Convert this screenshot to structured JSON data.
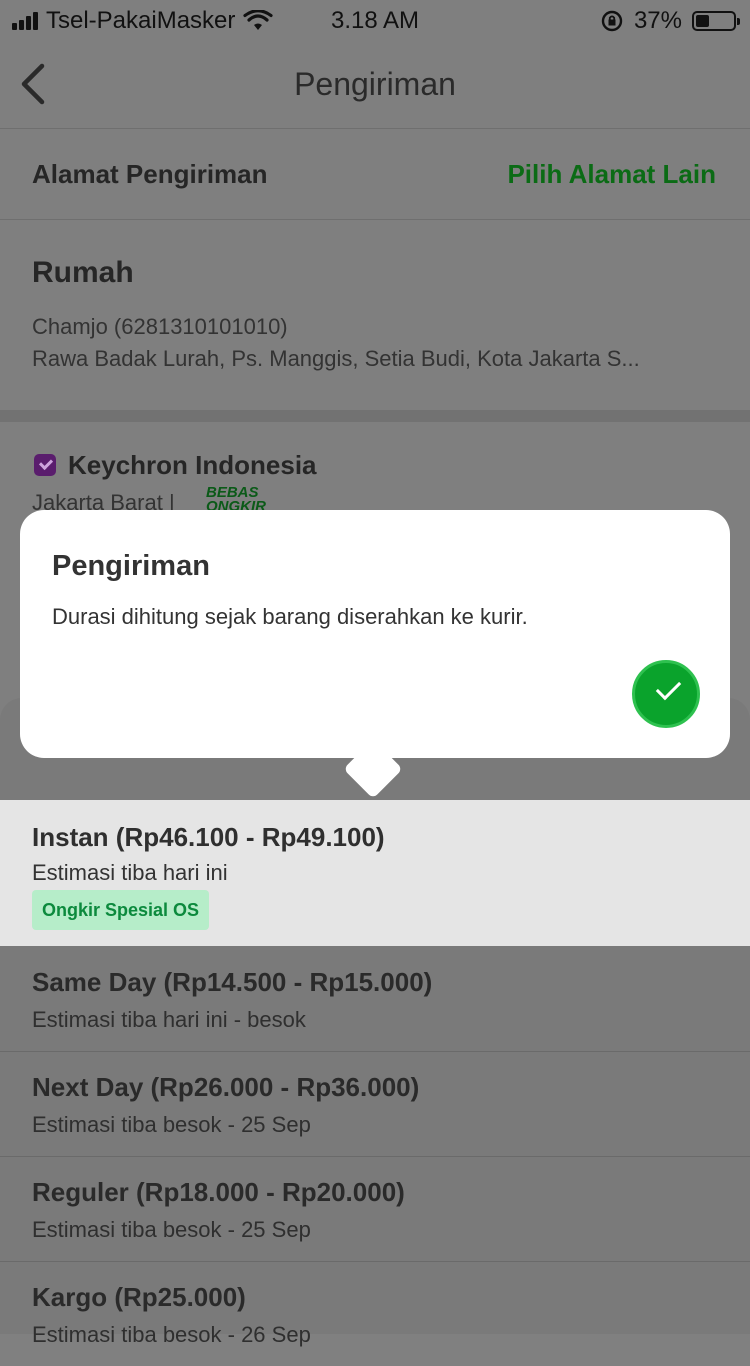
{
  "status": {
    "carrier": "Tsel-PakaiMasker",
    "time": "3.18 AM",
    "battery_percent": "37%",
    "battery_level": 0.37
  },
  "nav": {
    "title": "Pengiriman",
    "back_icon": "chevron-left-icon"
  },
  "address": {
    "section_title": "Alamat Pengiriman",
    "change_link": "Pilih Alamat Lain",
    "label": "Rumah",
    "contact": "Chamjo (6281310101010)",
    "line": "Rawa Badak Lurah, Ps. Manggis, Setia Budi, Kota Jakarta S..."
  },
  "shop": {
    "name": "Keychron Indonesia",
    "city": "Jakarta Barat |",
    "ongkir_logo": "BEBAS ONGKIR"
  },
  "popup": {
    "title": "Pengiriman",
    "text": "Durasi dihitung sejak barang diserahkan ke kurir.",
    "confirm_icon": "check-icon"
  },
  "options": [
    {
      "title": "Instan (Rp46.100 - Rp49.100)",
      "subtitle": "Estimasi tiba hari ini",
      "tag": "Ongkir Spesial OS"
    },
    {
      "title": "Same Day (Rp14.500 - Rp15.000)",
      "subtitle": "Estimasi tiba hari ini - besok"
    },
    {
      "title": "Next Day (Rp26.000 - Rp36.000)",
      "subtitle": "Estimasi tiba besok - 25 Sep"
    },
    {
      "title": "Reguler (Rp18.000 - Rp20.000)",
      "subtitle": "Estimasi tiba besok - 25 Sep"
    },
    {
      "title": "Kargo (Rp25.000)",
      "subtitle": "Estimasi tiba besok - 26 Sep"
    }
  ],
  "colors": {
    "accent_green": "#0aa32c",
    "link_green": "#0b6b15",
    "tag_bg": "#b6edc9",
    "tag_text": "#0c8a3d"
  }
}
